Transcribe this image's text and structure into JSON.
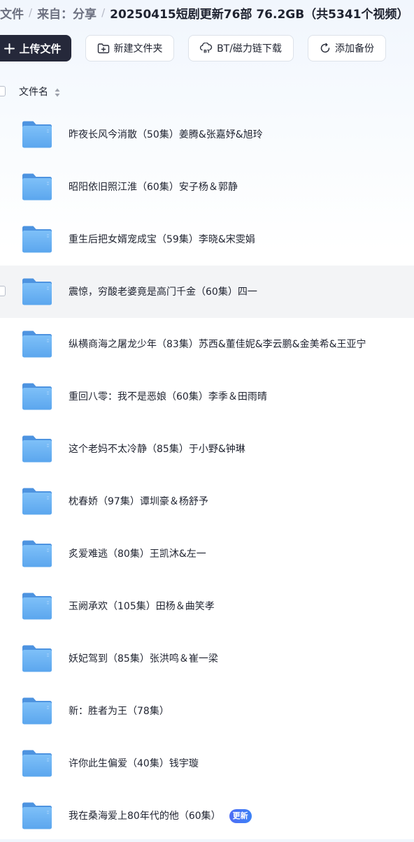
{
  "breadcrumb": {
    "root": "文件",
    "from": "来自：分享",
    "current": "20250415短剧更新76部 76.2GB（共5341个视频）"
  },
  "toolbar": {
    "upload_label": "上传文件",
    "new_folder_label": "新建文件夹",
    "bt_label": "BT/磁力链下载",
    "backup_label": "添加备份"
  },
  "list_header": {
    "name_label": "文件名"
  },
  "files": [
    {
      "name": "昨夜长风今消散（50集）姜腾&张嘉妤&旭玲"
    },
    {
      "name": "昭阳依旧照江淮（60集）安子杨＆郭静"
    },
    {
      "name": "重生后把女婿宠成宝（59集）李晓&宋雯娟"
    },
    {
      "name": "震惊，穷酸老婆竟是高门千金（60集）四一"
    },
    {
      "name": "纵横商海之屠龙少年（83集）苏西&董佳妮&李云鹏&金美希&王亚宁"
    },
    {
      "name": "重回八零：我不是恶娘（60集）李季＆田雨晴"
    },
    {
      "name": "这个老妈不太冷静（85集）于小野&钟琳"
    },
    {
      "name": "枕春娇（97集）谭圳豪＆杨舒予"
    },
    {
      "name": "炙爱难逃（80集）王凯沐&左一"
    },
    {
      "name": "玉阙承欢（105集）田杨＆曲笑孝"
    },
    {
      "name": "妖妃驾到（85集）张洪鸣＆崔一梁"
    },
    {
      "name": "新：胜者为王（78集）"
    },
    {
      "name": "许你此生偏爱（40集）钱宇璇"
    },
    {
      "name": "我在桑海爱上80年代的他（60集）",
      "badge": "更新"
    }
  ],
  "colors": {
    "accent": "#4f6df5",
    "primary_button": "#25283a",
    "folder": "#5ba6ee"
  }
}
